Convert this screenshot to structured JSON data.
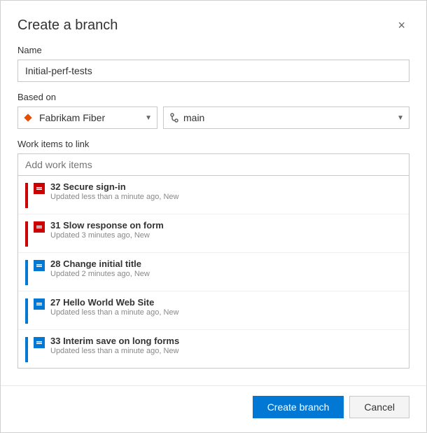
{
  "dialog": {
    "title": "Create a branch",
    "close_label": "×"
  },
  "name_field": {
    "label": "Name",
    "value": "Initial-perf-tests",
    "placeholder": ""
  },
  "based_on": {
    "label": "Based on",
    "repo_options": [
      "Fabrikam Fiber"
    ],
    "repo_selected": "Fabrikam Fiber",
    "branch_options": [
      "main"
    ],
    "branch_selected": "main"
  },
  "work_items": {
    "label": "Work items to link",
    "placeholder": "Add work items",
    "items": [
      {
        "id": 32,
        "title": "Secure sign-in",
        "meta": "Updated less than a minute ago, New",
        "color": "#cc0000",
        "icon_color": "#cc0000"
      },
      {
        "id": 31,
        "title": "Slow response on form",
        "meta": "Updated 3 minutes ago, New",
        "color": "#cc0000",
        "icon_color": "#cc0000"
      },
      {
        "id": 28,
        "title": "Change initial title",
        "meta": "Updated 2 minutes ago, New",
        "color": "#0078d4",
        "icon_color": "#0078d4"
      },
      {
        "id": 27,
        "title": "Hello World Web Site",
        "meta": "Updated less than a minute ago, New",
        "color": "#0078d4",
        "icon_color": "#0078d4"
      },
      {
        "id": 33,
        "title": "Interim save on long forms",
        "meta": "Updated less than a minute ago, New",
        "color": "#0078d4",
        "icon_color": "#0078d4"
      }
    ]
  },
  "footer": {
    "create_label": "Create branch",
    "cancel_label": "Cancel"
  }
}
